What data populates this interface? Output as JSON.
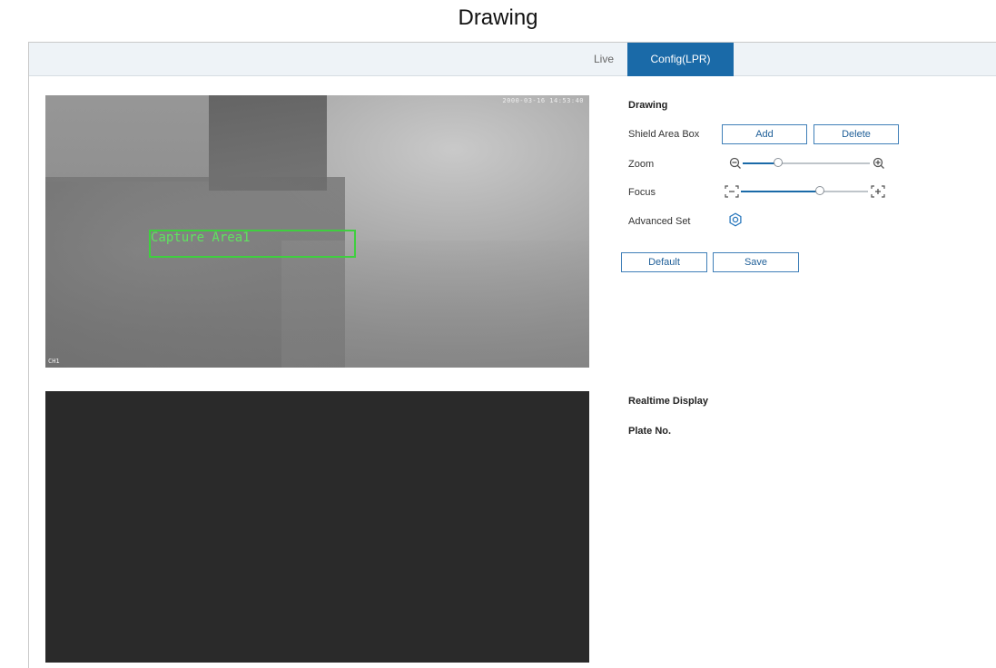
{
  "page": {
    "title": "Drawing"
  },
  "tabs": [
    {
      "label": "Live",
      "active": false
    },
    {
      "label": "Config(LPR)",
      "active": true
    }
  ],
  "video": {
    "timestamp": "2000-03-16 14:53:40",
    "corner_mark": "CH1",
    "capture_area_label": "Capture Area1"
  },
  "drawing": {
    "title": "Drawing",
    "shield_area_box_label": "Shield Area Box",
    "add_label": "Add",
    "delete_label": "Delete",
    "zoom_label": "Zoom",
    "zoom_level": 0.28,
    "focus_label": "Focus",
    "focus_level": 0.62,
    "advanced_set_label": "Advanced Set",
    "default_label": "Default",
    "save_label": "Save"
  },
  "realtime": {
    "title": "Realtime Display",
    "plate_no_label": "Plate No."
  },
  "colors": {
    "accent": "#1a6aa8",
    "capture_box": "#3fcf3f"
  },
  "icons": {
    "zoom_out": "zoom-out-icon",
    "zoom_in": "zoom-in-icon",
    "focus_near": "focus-near-icon",
    "focus_far": "focus-far-icon",
    "advanced": "gear-icon"
  }
}
